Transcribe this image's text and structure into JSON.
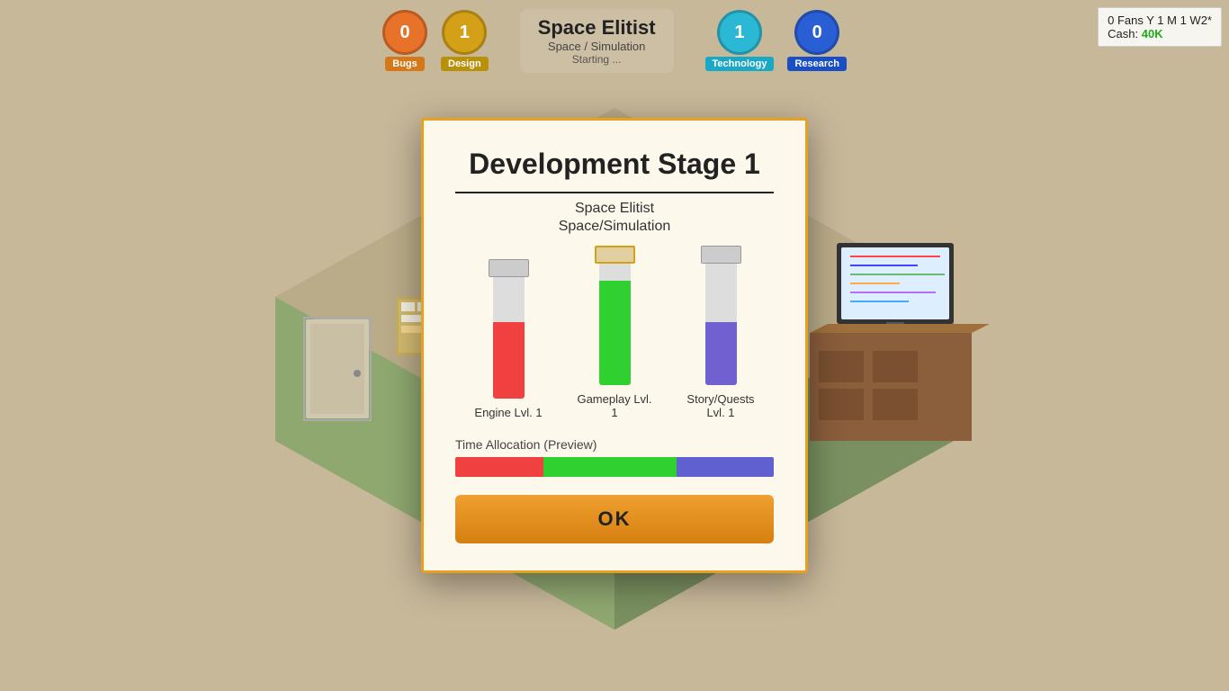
{
  "hud": {
    "bugs_count": "0",
    "bugs_label": "Bugs",
    "design_count": "1",
    "design_label": "Design",
    "game_title": "Space Elitist",
    "game_genre": "Space / Simulation",
    "game_status": "Starting ...",
    "technology_count": "1",
    "technology_label": "Technology",
    "research_count": "0",
    "research_label": "Research"
  },
  "stats": {
    "fans": "0 Fans Y 1 M 1 W2*",
    "cash_label": "Cash:",
    "cash_value": "40K"
  },
  "modal": {
    "title": "Development Stage 1",
    "game_name": "Space Elitist",
    "genre": "Space/Simulation",
    "sliders": [
      {
        "label": "Engine Lvl. 1",
        "color": "red"
      },
      {
        "label": "Gameplay Lvl. 1",
        "color": "green"
      },
      {
        "label": "Story/Quests Lvl. 1",
        "color": "blue"
      }
    ],
    "time_allocation_label": "Time Allocation (Preview)",
    "ok_label": "OK"
  }
}
